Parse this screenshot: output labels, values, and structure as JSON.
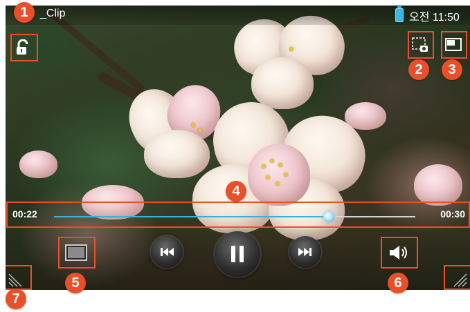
{
  "status_bar": {
    "title": "_Clip",
    "ampm": "오전",
    "time": "11:50"
  },
  "player": {
    "elapsed": "00:22",
    "duration": "00:30",
    "progress_fraction": 0.76
  },
  "icons": {
    "lock": "unlock-icon",
    "capture": "screen-capture-icon",
    "popup": "popup-player-icon",
    "screen_mode": "screen-mode-icon",
    "prev": "previous-icon",
    "pause": "pause-icon",
    "next": "next-icon",
    "volume": "volume-icon",
    "resize_left": "resize-handle-icon",
    "resize_right": "resize-handle-icon"
  },
  "callouts": {
    "c1": "1",
    "c2": "2",
    "c3": "3",
    "c4": "4",
    "c5": "5",
    "c6": "6",
    "c7": "7"
  },
  "colors": {
    "callout": "#e8502a",
    "progress": "#38b3d8"
  }
}
